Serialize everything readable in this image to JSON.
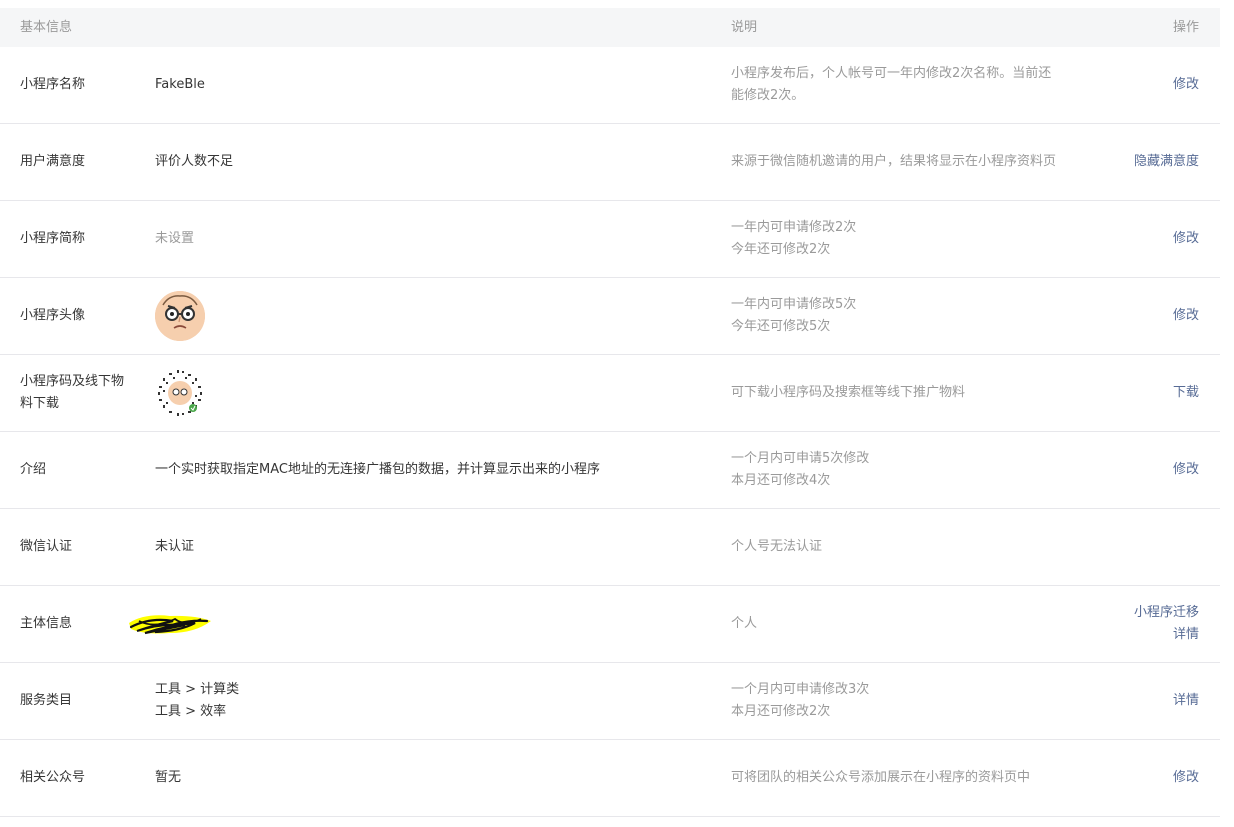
{
  "header": {
    "col_basic": "基本信息",
    "col_desc": "说明",
    "col_op": "操作"
  },
  "rows": [
    {
      "label": "小程序名称",
      "value": "FakeBle",
      "desc": [
        "小程序发布后，个人帐号可一年内修改2次名称。当前还",
        "能修改2次。"
      ],
      "ops": [
        "修改"
      ]
    },
    {
      "label": "用户满意度",
      "value": "评价人数不足",
      "desc": [
        "来源于微信随机邀请的用户，结果将显示在小程序资料页"
      ],
      "ops": [
        "隐藏满意度"
      ]
    },
    {
      "label": "小程序简称",
      "value": "未设置",
      "desc": [
        "一年内可申请修改2次",
        "今年还可修改2次"
      ],
      "ops": [
        "修改"
      ]
    },
    {
      "label": "小程序头像",
      "value": "",
      "desc": [
        "一年内可申请修改5次",
        "今年还可修改5次"
      ],
      "ops": [
        "修改"
      ]
    },
    {
      "label": [
        "小程序码及线下物",
        "料下载"
      ],
      "value": "",
      "desc": [
        "可下载小程序码及搜索框等线下推广物料"
      ],
      "ops": [
        "下载"
      ]
    },
    {
      "label": "介绍",
      "value": "一个实时获取指定MAC地址的无连接广播包的数据，并计算显示出来的小程序",
      "desc": [
        "一个月内可申请5次修改",
        "本月还可修改4次"
      ],
      "ops": [
        "修改"
      ]
    },
    {
      "label": "微信认证",
      "value": "未认证",
      "desc": [
        "个人号无法认证"
      ],
      "ops": []
    },
    {
      "label": "主体信息",
      "value": "",
      "desc": [
        "个人"
      ],
      "ops": [
        "小程序迁移",
        "详情"
      ]
    },
    {
      "label": "服务类目",
      "value": [
        "工具 > 计算类",
        "工具 > 效率"
      ],
      "desc": [
        "一个月内可申请修改3次",
        "本月还可修改2次"
      ],
      "ops": [
        "详情"
      ]
    },
    {
      "label": "相关公众号",
      "value": "暂无",
      "desc": [
        "可将团队的相关公众号添加展示在小程序的资料页中"
      ],
      "ops": [
        "修改"
      ]
    }
  ],
  "colors": {
    "link": "#576b95",
    "muted": "#9a9a9a",
    "text": "#353535",
    "header_bg": "#f5f6f7",
    "divider": "#e7e7eb",
    "redaction": "#ffff00"
  },
  "icons": {
    "avatar": "cartoon-face-avatar-icon",
    "qr": "mini-program-code-icon",
    "redacted": "redaction-scribble"
  }
}
